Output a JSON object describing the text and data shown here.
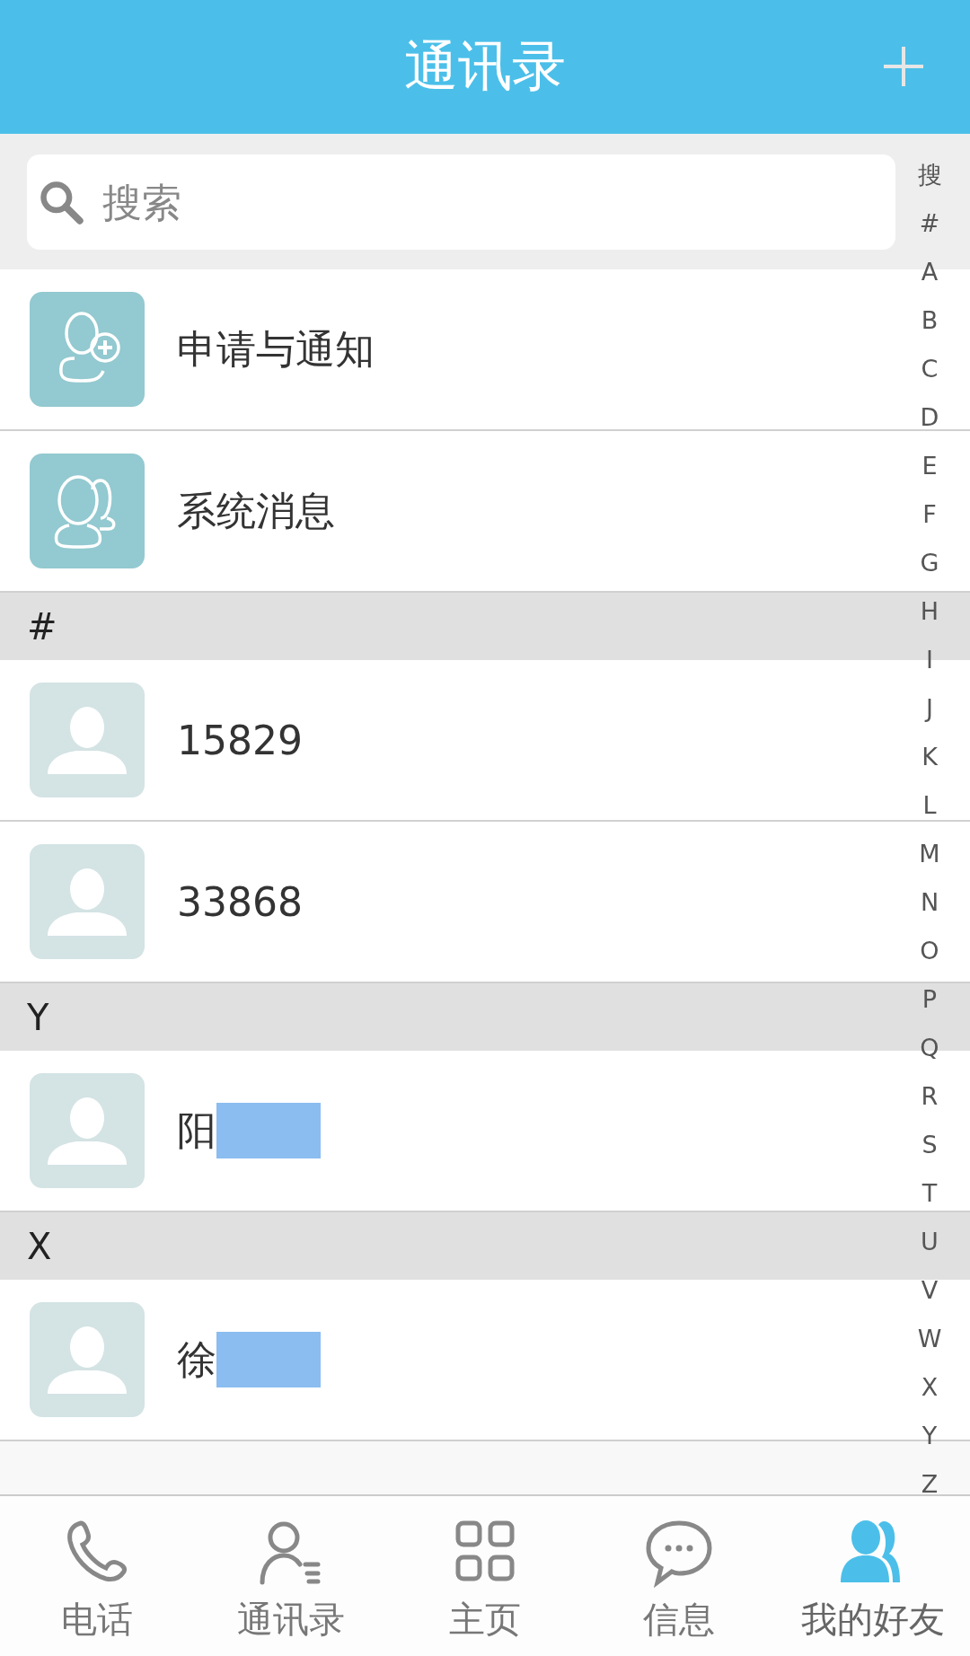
{
  "header": {
    "title": "通讯录"
  },
  "search": {
    "placeholder": "搜索"
  },
  "entries": [
    {
      "kind": "request",
      "label": "申请与通知"
    },
    {
      "kind": "system",
      "label": "系统消息"
    }
  ],
  "sections": [
    {
      "label": "#",
      "contacts": [
        {
          "name": "15829",
          "redacted": false
        },
        {
          "name": "33868",
          "redacted": false
        }
      ]
    },
    {
      "label": "Y",
      "contacts": [
        {
          "name": "阳",
          "redacted": true
        }
      ]
    },
    {
      "label": "X",
      "contacts": [
        {
          "name": "徐",
          "redacted": true
        }
      ]
    }
  ],
  "index": [
    "搜",
    "#",
    "A",
    "B",
    "C",
    "D",
    "E",
    "F",
    "G",
    "H",
    "I",
    "J",
    "K",
    "L",
    "M",
    "N",
    "O",
    "P",
    "Q",
    "R",
    "S",
    "T",
    "U",
    "V",
    "W",
    "X",
    "Y",
    "Z"
  ],
  "tabs": [
    {
      "kind": "phone",
      "label": "电话",
      "selected": false
    },
    {
      "kind": "contacts",
      "label": "通讯录",
      "selected": false
    },
    {
      "kind": "home",
      "label": "主页",
      "selected": false
    },
    {
      "kind": "messages",
      "label": "信息",
      "selected": false
    },
    {
      "kind": "friends",
      "label": "我的好友",
      "selected": true
    }
  ]
}
